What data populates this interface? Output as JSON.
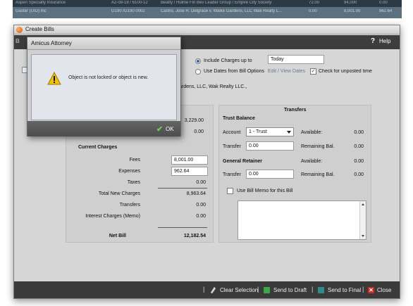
{
  "background": {
    "row1": [
      "Aspen Specialty Insurance",
      "A2-09-18 / 6100-12",
      "Beatty / Hulme Fin Bev Leader Group / Empire City Society",
      "72.00",
      "94,000",
      "0.00"
    ],
    "row2": [
      "Gaster (UID) Inc",
      "G190 /G190 0002",
      "Castro, Jose R. Delgrace v. Walke Gardens, LLC Wak Realty L...",
      "0.00",
      "8,001.00",
      "962.64"
    ]
  },
  "window": {
    "title": "Create Bills",
    "help_label": "Help",
    "help_icon": "?",
    "header_left": "B"
  },
  "options": {
    "include_charges_label": "Include Charges up to",
    "include_charges_value": "Today",
    "use_dates_label": "Use Dates from Bill Options",
    "edit_view_dates": "Edit / View Dates",
    "check_unposted_label": "Check for unposted time",
    "check_unposted_checked": true,
    "matter_text": "ardens, LLC, Wak Realty LLC.,"
  },
  "summary": {
    "partial_val1": "3,229.00",
    "partial_val2": "0.00",
    "current_charges_title": "Current Charges",
    "fees_label": "Fees",
    "fees_value": "8,001.00",
    "expenses_label": "Expenses",
    "expenses_value": "962.64",
    "taxes_label": "Taxes",
    "taxes_value": "0.00",
    "total_new_label": "Total New Charges",
    "total_new_value": "8,963.64",
    "transfers_label": "Transfers",
    "transfers_value": "0.00",
    "interest_label": "Interest Charges (Memo)",
    "interest_value": "0.00",
    "net_bill_label": "Net Bill",
    "net_bill_value": "12,182.54"
  },
  "transfers": {
    "title": "Transfers",
    "trust_balance_title": "Trust Balance",
    "account_label": "Account",
    "account_value": "1 - Trust",
    "available_label": "Available:",
    "available_value": "0.00",
    "transfer_label": "Transfer",
    "transfer_value": "0.00",
    "remaining_label": "Remaining Bal.",
    "remaining_value": "0.00",
    "retainer_title": "General Retainer",
    "ret_available_label": "Available:",
    "ret_available_value": "0.00",
    "ret_transfer_label": "Transfer",
    "ret_transfer_value": "0.00",
    "ret_remaining_label": "Remaining Bal.",
    "ret_remaining_value": "0.00",
    "use_memo_label": "Use Bill Memo for this Bill",
    "use_memo_checked": false
  },
  "footer": {
    "clear_selection": "Clear Selection",
    "send_draft": "Send to Draft",
    "send_final": "Send to Final",
    "close": "Close"
  },
  "dialog": {
    "title": "Amicus Attorney",
    "message": "Object is not locked or object is new.",
    "ok_label": "OK",
    "ok_icon": "check-icon",
    "warning_icon": "warning-icon"
  },
  "colors": {
    "header_bg": "#3d3d3d",
    "footer_bg": "#3a3a3a",
    "warning_yellow": "#f2c200",
    "ok_green": "#6bd04a",
    "close_red": "#d02a20",
    "draft_green": "#3aa84a",
    "final_teal": "#2e8c8c"
  }
}
